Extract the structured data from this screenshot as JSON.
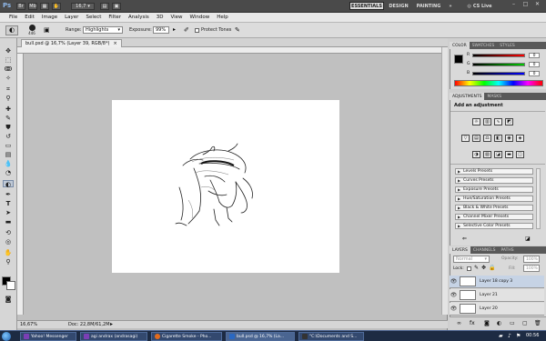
{
  "app": {
    "logo": "Ps",
    "zoom_value": "16,7",
    "workspaces": [
      "ESSENTIALS",
      "DESIGN",
      "PAINTING",
      "»"
    ],
    "cs_live": "CS Live",
    "window_buttons": [
      "–",
      "□",
      "✕"
    ]
  },
  "menu": [
    "File",
    "Edit",
    "Image",
    "Layer",
    "Select",
    "Filter",
    "Analysis",
    "3D",
    "View",
    "Window",
    "Help"
  ],
  "options": {
    "brush_size": "446",
    "range_label": "Range:",
    "range_value": "Highlights",
    "exposure_label": "Exposure:",
    "exposure_value": "99%",
    "protect_tones": "Protect Tones"
  },
  "document": {
    "tab_title": "bull.psd @ 16,7% (Layer 39, RGB/8*)",
    "tab_close": "×",
    "status_zoom": "16,67%",
    "status_doc": "Doc: 22,8M/61,2M"
  },
  "panels": {
    "color_tabs": [
      "COLOR",
      "SWATCHES",
      "STYLES"
    ],
    "color_channels": [
      {
        "label": "R",
        "value": "0"
      },
      {
        "label": "G",
        "value": "0"
      },
      {
        "label": "B",
        "value": "0"
      }
    ],
    "adjust_tabs": [
      "ADJUSTMENTS",
      "MASKS"
    ],
    "adjust_heading": "Add an adjustment",
    "presets": [
      "Levels Presets",
      "Curves Presets",
      "Exposure Presets",
      "Hue/Saturation Presets",
      "Black & White Presets",
      "Channel Mixer Presets",
      "Selective Color Presets"
    ],
    "layers_tabs": [
      "LAYERS",
      "CHANNELS",
      "PATHS"
    ],
    "blend_mode": "Normal",
    "opacity_label": "Opacity:",
    "opacity_value": "100%",
    "lock_label": "Lock:",
    "fill_label": "Fill:",
    "fill_value": "100%",
    "layers": [
      {
        "name": "Layer 18 copy 3",
        "selected": true
      },
      {
        "name": "Layer 21",
        "selected": false
      },
      {
        "name": "Layer 20",
        "selected": false
      }
    ]
  },
  "taskbar": {
    "items": [
      {
        "label": "Yahoo! Messenger",
        "color": "#7b3fb5"
      },
      {
        "label": "agi andrax (andrasagi)",
        "color": "#7b3fb5"
      },
      {
        "label": "Cigarette Smoke - Pho...",
        "color": "#e36b1c"
      },
      {
        "label": "bull.psd @ 16,7% (La...",
        "color": "#2a68c2"
      },
      {
        "label": "\"C:\\Documents and S...",
        "color": "#333333"
      }
    ],
    "time": "00:56"
  },
  "colors": {
    "accent": "#d9d9d9",
    "taskbar": "#1d2b43",
    "canvas_bg": "#c0c0c0"
  }
}
